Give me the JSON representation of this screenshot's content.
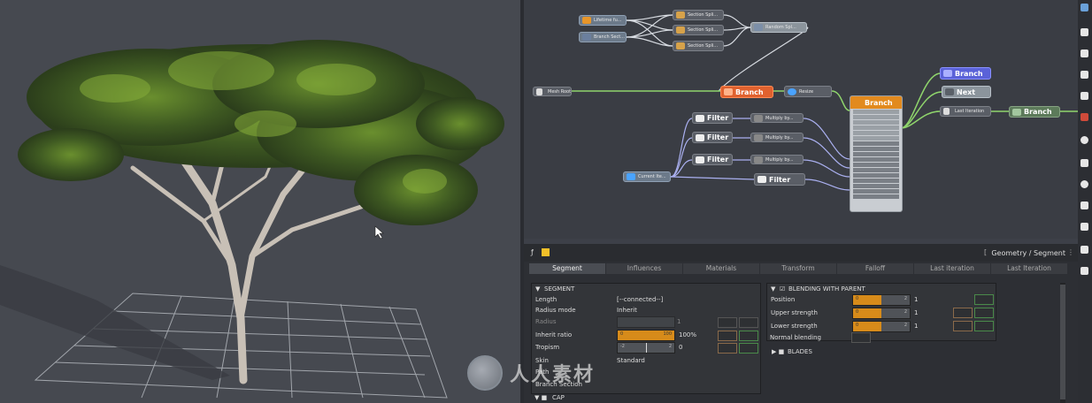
{
  "graph": {
    "nodes": {
      "lifetime": "Lifetime fu...",
      "branch_section": "Branch Sect...",
      "section_split_1": "Section Spli...",
      "section_split_2": "Section Spli...",
      "section_split_3": "Section Spli...",
      "random_split": "Random Spl...",
      "mesh_root": "Mesh Root",
      "branch_main": "Branch",
      "resize": "Resize",
      "branch_selected": "Branch",
      "branch_top": "Branch",
      "next": "Next",
      "last_iteration": "Last Iteration",
      "branch_right": "Branch",
      "filter_1": "Filter",
      "filter_2": "Filter",
      "filter_3": "Filter",
      "filter_4": "Filter",
      "multiply_1": "Multiply by...",
      "multiply_2": "Multiply by...",
      "multiply_3": "Multiply by...",
      "current_iter": "Current Ite..."
    }
  },
  "panel": {
    "breadcrumb": "Geometry / Segment",
    "tabs": [
      "Segment",
      "Influences",
      "Materials",
      "Transform",
      "Falloff",
      "Last iteration",
      "Last Iteration"
    ],
    "segment": {
      "title": "SEGMENT",
      "length_label": "Length",
      "length_value": "[--connected--]",
      "radius_mode_label": "Radius mode",
      "radius_mode_value": "Inherit",
      "radius_label": "Radius",
      "radius_hi": "1",
      "inherit_ratio_label": "Inherit ratio",
      "inherit_ratio_lo": "0",
      "inherit_ratio_hi": "100",
      "inherit_ratio_value": "100%",
      "tropism_label": "Tropism",
      "tropism_lo": "-2",
      "tropism_hi": "2",
      "tropism_value": "0",
      "skin_label": "Skin",
      "skin_value": "Standard",
      "path_label": "Path",
      "branch_section_label": "Branch Section"
    },
    "blending": {
      "title": "BLENDING WITH PARENT",
      "position_label": "Position",
      "position_lo": "0",
      "position_hi": "2",
      "position_value": "1",
      "upper_label": "Upper strength",
      "upper_lo": "0",
      "upper_hi": "2",
      "upper_value": "1",
      "lower_label": "Lower strength",
      "lower_lo": "0",
      "lower_hi": "2",
      "lower_value": "1",
      "normal_blending_label": "Normal blending"
    },
    "blades_title": "BLADES",
    "cap_title": "CAP"
  },
  "watermark": {
    "text": "人人素材"
  }
}
